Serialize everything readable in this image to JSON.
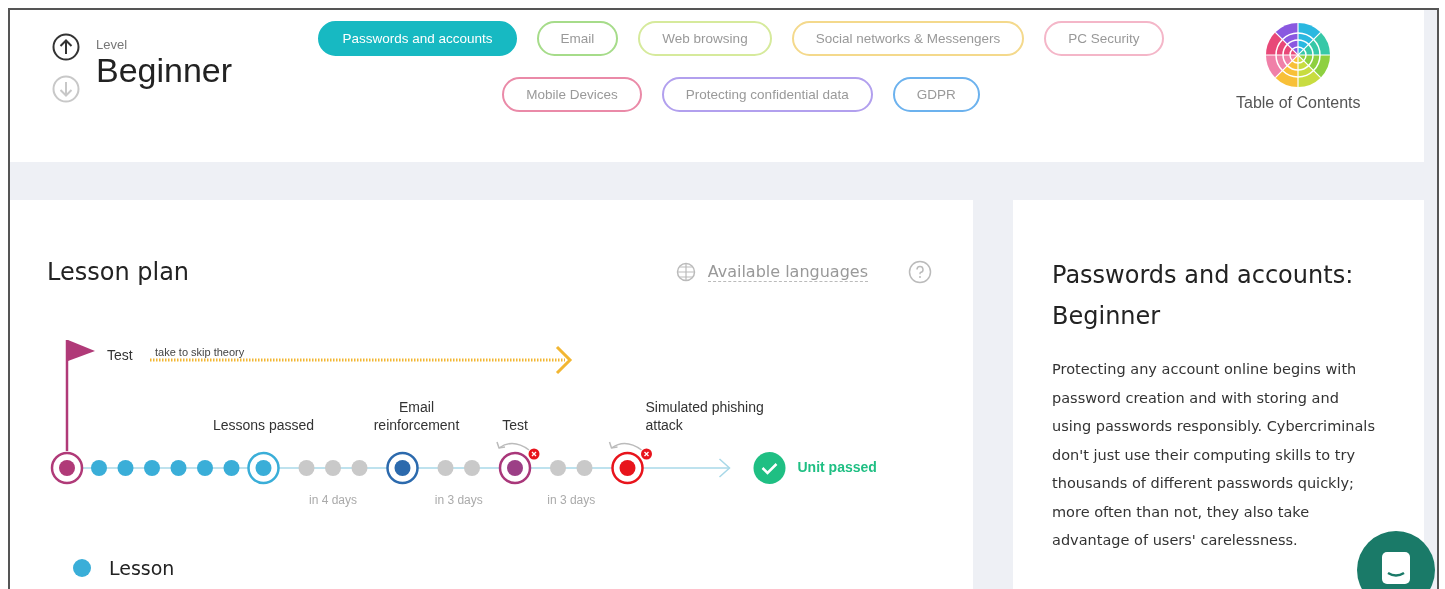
{
  "header": {
    "level_label": "Level",
    "level": "Beginner",
    "topics": [
      {
        "label": "Passwords and accounts",
        "selected": true,
        "color": "#17b9c2"
      },
      {
        "label": "Email",
        "selected": false,
        "color": "#a6dc8a"
      },
      {
        "label": "Web browsing",
        "selected": false,
        "color": "#d6ea9c"
      },
      {
        "label": "Social networks & Messengers",
        "selected": false,
        "color": "#f4d98c"
      },
      {
        "label": "PC Security",
        "selected": false,
        "color": "#f4b6c8"
      },
      {
        "label": "Mobile Devices",
        "selected": false,
        "color": "#ea8aa8"
      },
      {
        "label": "Protecting confidential data",
        "selected": false,
        "color": "#b2a0ee"
      },
      {
        "label": "GDPR",
        "selected": false,
        "color": "#6cb2ee"
      }
    ],
    "toc_label": "Table of Contents"
  },
  "lesson_plan": {
    "title": "Lesson plan",
    "languages_link": "Available languages",
    "timeline": {
      "test_label": "Test",
      "skip_hint": "take to skip theory",
      "finish_label": "Unit passed",
      "nodes": [
        {
          "kind": "start",
          "retry": false
        },
        {
          "kind": "lesson",
          "retry": false
        },
        {
          "kind": "lesson",
          "retry": false
        },
        {
          "kind": "lesson",
          "retry": false
        },
        {
          "kind": "lesson",
          "retry": false
        },
        {
          "kind": "lesson",
          "retry": false
        },
        {
          "kind": "lesson",
          "retry": false
        },
        {
          "kind": "milestone",
          "label": "Lessons passed",
          "retry": false
        },
        {
          "kind": "wait",
          "note": "in 4 days",
          "retry": false
        },
        {
          "kind": "wait",
          "retry": false
        },
        {
          "kind": "wait",
          "retry": false
        },
        {
          "kind": "email",
          "label": "Email reinforcement",
          "retry": false
        },
        {
          "kind": "wait",
          "note": "in 3 days",
          "retry": false
        },
        {
          "kind": "wait",
          "retry": false
        },
        {
          "kind": "test",
          "label": "Test",
          "retry": true
        },
        {
          "kind": "wait",
          "note": "in 3 days",
          "retry": false
        },
        {
          "kind": "wait",
          "retry": false
        },
        {
          "kind": "phishing",
          "label": "Simulated phishing attack",
          "retry": true
        }
      ]
    },
    "legend": [
      {
        "label": "Lesson",
        "color": "#3aaed8"
      }
    ]
  },
  "summary": {
    "title": "Passwords and accounts: Beginner",
    "body": "Protecting any account online begins with password creation and with storing and using passwords responsibly. Cybercriminals don't just use their computing skills to try thousands of different passwords quickly; more often than not, they also take advantage of users' carelessness."
  }
}
